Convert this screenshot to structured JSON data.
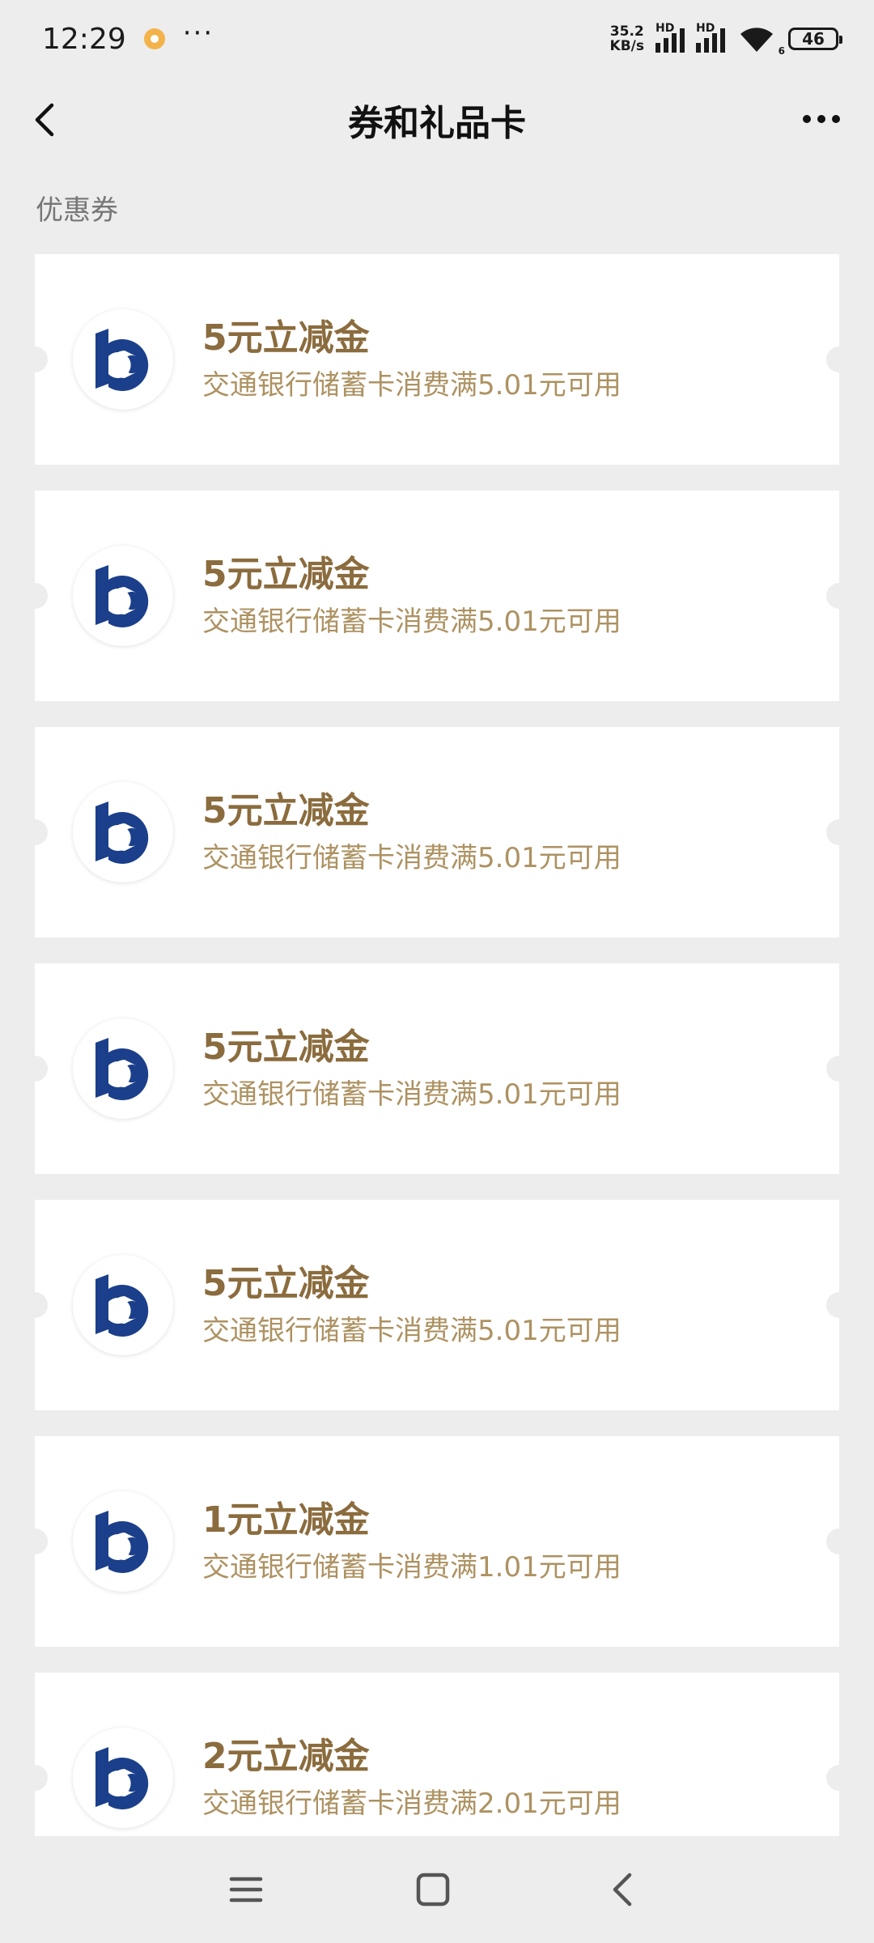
{
  "status_bar": {
    "time": "12:29",
    "more": "···",
    "net_speed_value": "35.2",
    "net_speed_unit": "KB/s",
    "signal1_label": "HD",
    "signal2_label": "HD",
    "wifi_label": "6",
    "battery": "46"
  },
  "header": {
    "title": "券和礼品卡"
  },
  "section": {
    "label": "优惠券"
  },
  "coupons": [
    {
      "title": "5元立减金",
      "desc": "交通银行储蓄卡消费满5.01元可用"
    },
    {
      "title": "5元立减金",
      "desc": "交通银行储蓄卡消费满5.01元可用"
    },
    {
      "title": "5元立减金",
      "desc": "交通银行储蓄卡消费满5.01元可用"
    },
    {
      "title": "5元立减金",
      "desc": "交通银行储蓄卡消费满5.01元可用"
    },
    {
      "title": "5元立减金",
      "desc": "交通银行储蓄卡消费满5.01元可用"
    },
    {
      "title": "1元立减金",
      "desc": "交通银行储蓄卡消费满1.01元可用"
    },
    {
      "title": "2元立减金",
      "desc": "交通银行储蓄卡消费满2.01元可用"
    }
  ],
  "colors": {
    "accent_title": "#8b6c3e",
    "accent_desc": "#ad9262",
    "bank_logo_blue": "#1b3f8a",
    "notification_dot": "#f3b34a"
  },
  "icons": {
    "back": "chevron-left-icon",
    "menu": "more-horizontal-icon",
    "bank_logo": "bocom-logo-icon",
    "nav_menu": "hamburger-icon",
    "nav_home": "square-icon",
    "nav_back": "chevron-left-icon"
  }
}
